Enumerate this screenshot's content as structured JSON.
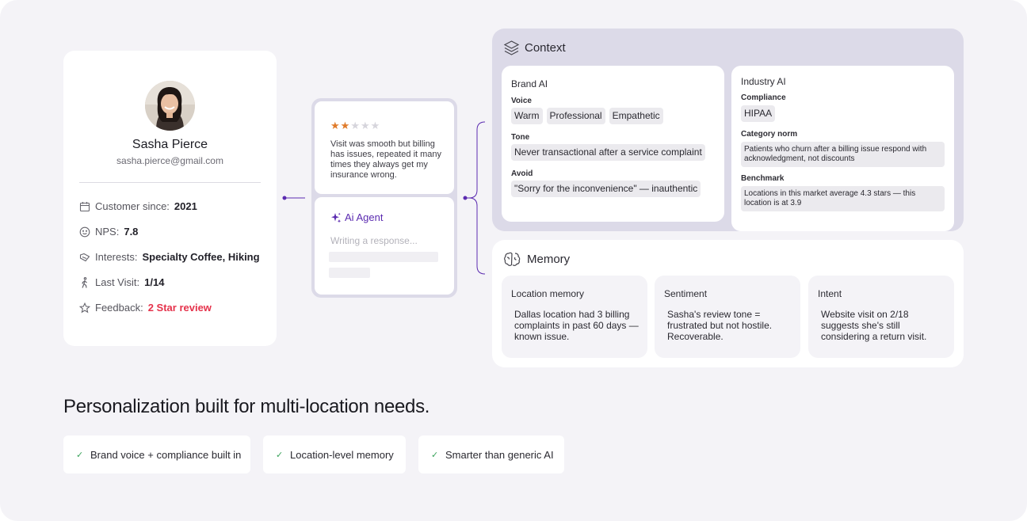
{
  "profile": {
    "name": "Sasha Pierce",
    "email": "sasha.pierce@gmail.com",
    "customer_since_label": "Customer since:",
    "customer_since_value": "2021",
    "nps_label": "NPS:",
    "nps_value": "7.8",
    "interests_label": "Interests:",
    "interests_value": "Specialty Coffee, Hiking",
    "last_visit_label": "Last Visit:",
    "last_visit_value": "1/14",
    "feedback_label": "Feedback:",
    "feedback_value": "2 Star review"
  },
  "review": {
    "rating": 2,
    "max_rating": 5,
    "text": "Visit was smooth but billing has issues, repeated it many times they always get my insurance wrong."
  },
  "agent": {
    "title": "Ai Agent",
    "placeholder": "Writing a response..."
  },
  "context": {
    "title": "Context",
    "brand": {
      "title": "Brand AI",
      "voice_label": "Voice",
      "voice_chips": [
        "Warm",
        "Professional",
        "Empathetic"
      ],
      "tone_label": "Tone",
      "tone_value": "Never transactional after a service complaint",
      "avoid_label": "Avoid",
      "avoid_value": "\"Sorry for the inconvenience\" — inauthentic"
    },
    "industry": {
      "title": "Industry AI",
      "compliance_label": "Compliance",
      "compliance_value": "HIPAA",
      "category_label": "Category norm",
      "category_value": "Patients who churn after a billing issue respond with acknowledgment, not discounts",
      "benchmark_label": "Benchmark",
      "benchmark_value": "Locations in this market average 4.3 stars — this location is at 3.9"
    }
  },
  "memory": {
    "title": "Memory",
    "cards": [
      {
        "title": "Location memory",
        "text": "Dallas location had 3 billing complaints in past 60 days — known issue."
      },
      {
        "title": "Sentiment",
        "text": "Sasha's review tone = frustrated but not hostile. Recoverable."
      },
      {
        "title": "Intent",
        "text": "Website visit on 2/18 suggests she's still considering a return visit."
      }
    ]
  },
  "headline": "Personalization built for multi-location needs.",
  "features": [
    "Brand voice + compliance built in",
    "Location-level memory",
    "Smarter than generic AI"
  ],
  "colors": {
    "accent": "#5b2bb0",
    "star": "#e07b2a",
    "alert": "#e5324b",
    "check": "#3aa35b",
    "panel": "#dcdae8"
  }
}
